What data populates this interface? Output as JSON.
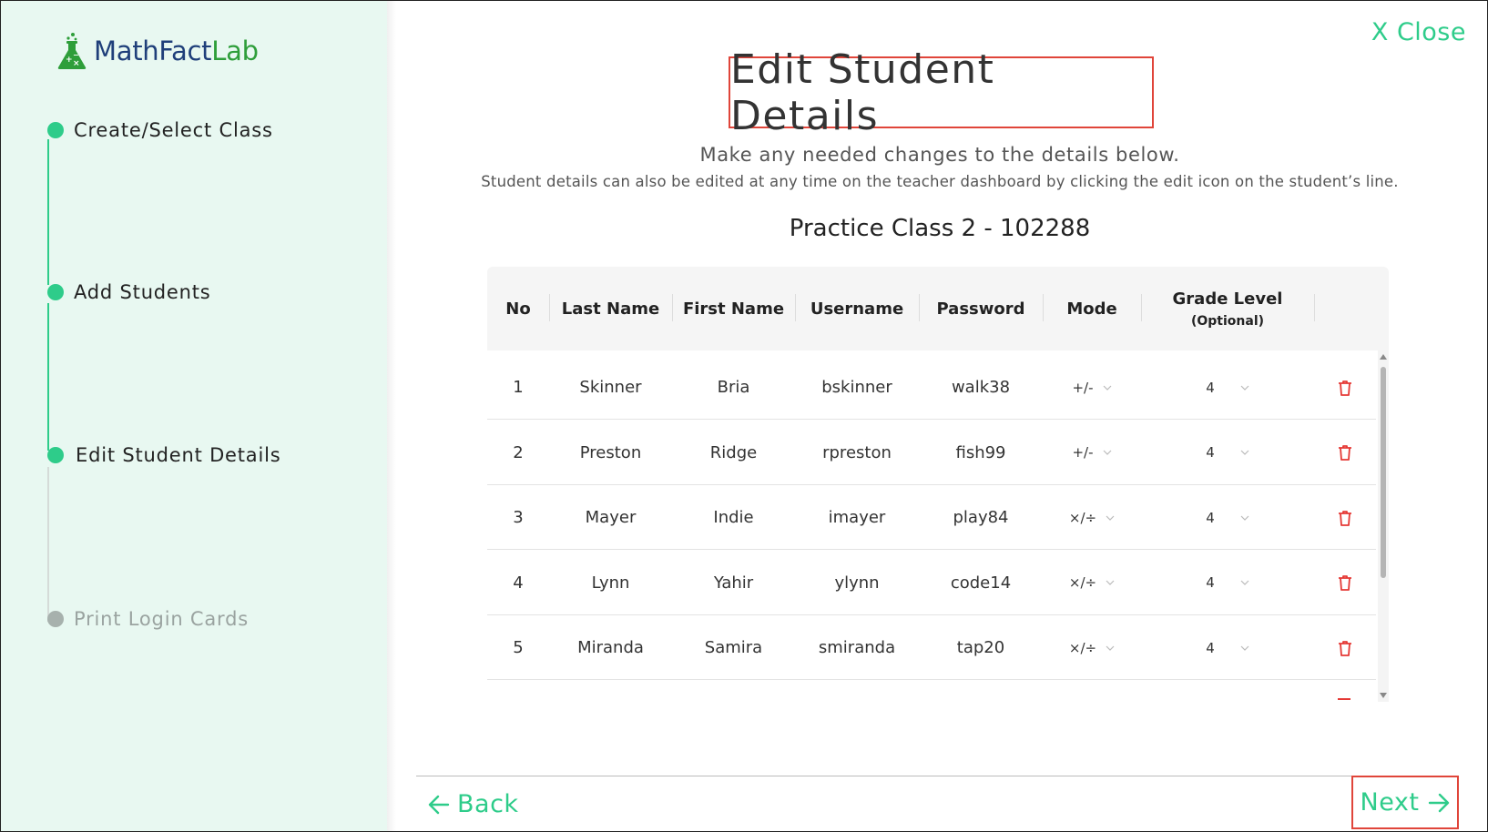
{
  "brand": {
    "name_part1": "MathFact",
    "name_part2": "Lab"
  },
  "steps": [
    {
      "label": "Create/Select Class",
      "state": "complete"
    },
    {
      "label": "Add Students",
      "state": "complete"
    },
    {
      "label": "Edit Student Details",
      "state": "current"
    },
    {
      "label": "Print Login Cards",
      "state": "pending"
    }
  ],
  "close_label": "X Close",
  "title": "Edit Student Details",
  "subtitle": "Make any needed changes to the details below.",
  "subtitle_note": "Student details can also be edited at any time on the teacher dashboard by clicking the edit icon on the student’s line.",
  "class_name": "Practice Class 2 - 102288",
  "table": {
    "headers": {
      "no": "No",
      "last_name": "Last Name",
      "first_name": "First Name",
      "username": "Username",
      "password": "Password",
      "mode": "Mode",
      "grade_level": "Grade Level",
      "grade_optional": "(Optional)"
    },
    "rows": [
      {
        "no": "1",
        "last_name": "Skinner",
        "first_name": "Bria",
        "username": "bskinner",
        "password": "walk38",
        "mode": "+/-",
        "grade": "4"
      },
      {
        "no": "2",
        "last_name": "Preston",
        "first_name": "Ridge",
        "username": "rpreston",
        "password": "fish99",
        "mode": "+/-",
        "grade": "4"
      },
      {
        "no": "3",
        "last_name": "Mayer",
        "first_name": "Indie",
        "username": "imayer",
        "password": "play84",
        "mode": "×/÷",
        "grade": "4"
      },
      {
        "no": "4",
        "last_name": "Lynn",
        "first_name": "Yahir",
        "username": "ylynn",
        "password": "code14",
        "mode": "×/÷",
        "grade": "4"
      },
      {
        "no": "5",
        "last_name": "Miranda",
        "first_name": "Samira",
        "username": "smiranda",
        "password": "tap20",
        "mode": "×/÷",
        "grade": "4"
      }
    ]
  },
  "footer": {
    "back_label": "Back",
    "next_label": "Next"
  },
  "colors": {
    "accent": "#2ecc8a",
    "highlight": "#e0453a",
    "sidebar_bg": "#e8f8f1",
    "delete": "#e53935"
  }
}
